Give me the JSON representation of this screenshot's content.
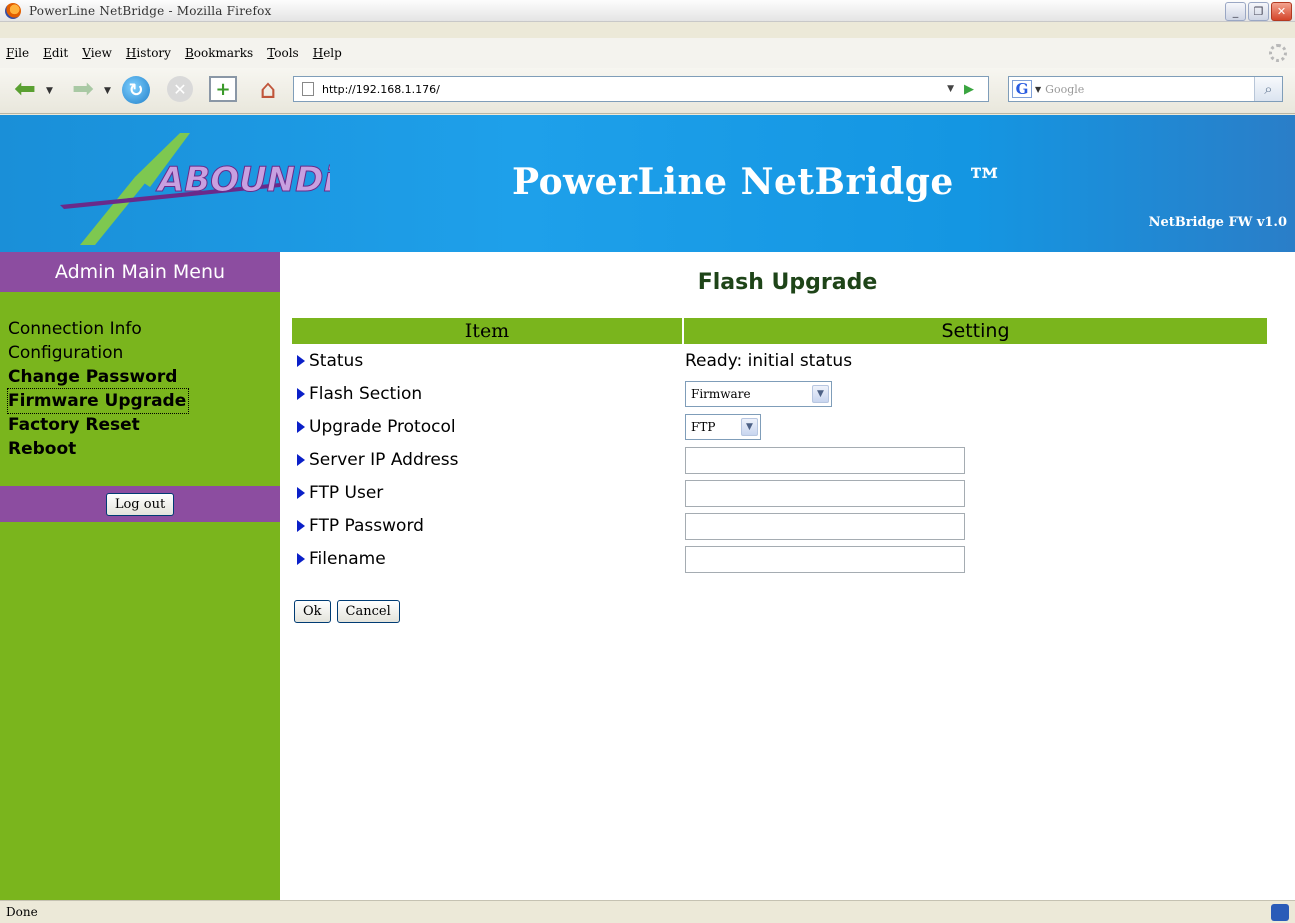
{
  "window": {
    "title": "PowerLine NetBridge - Mozilla Firefox",
    "controls": {
      "minimize": "_",
      "maximize": "❐",
      "close": "✕"
    }
  },
  "menubar": {
    "items": [
      "File",
      "Edit",
      "View",
      "History",
      "Bookmarks",
      "Tools",
      "Help"
    ]
  },
  "navbar": {
    "url": "http://192.168.1.176/",
    "search_placeholder": "Google",
    "google_glyph": "G"
  },
  "banner": {
    "logo_text": "ABOUNDi",
    "title": "PowerLine NetBridge ™",
    "fw_version": "NetBridge FW v1.0"
  },
  "sidebar": {
    "header": "Admin Main Menu",
    "items": [
      {
        "label": "Connection Info"
      },
      {
        "label": "Configuration"
      },
      {
        "label": "Change Password"
      },
      {
        "label": "Firmware Upgrade"
      },
      {
        "label": "Factory Reset"
      },
      {
        "label": "Reboot"
      }
    ],
    "logout_label": "Log out"
  },
  "main": {
    "title": "Flash Upgrade",
    "table": {
      "columns": [
        "Item",
        "Setting"
      ],
      "rows": [
        {
          "label": "Status",
          "value": "Ready: initial status"
        },
        {
          "label": "Flash Section",
          "value": "Firmware"
        },
        {
          "label": "Upgrade Protocol",
          "value": "FTP"
        },
        {
          "label": "Server IP Address",
          "value": ""
        },
        {
          "label": "FTP User",
          "value": ""
        },
        {
          "label": "FTP Password",
          "value": ""
        },
        {
          "label": "Filename",
          "value": ""
        }
      ]
    },
    "ok_label": "Ok",
    "cancel_label": "Cancel"
  },
  "statusbar": {
    "text": "Done"
  },
  "colors": {
    "sidebar_green": "#7ab51d",
    "sidebar_purple": "#8c4da0",
    "banner_blue": "#1ea0ea",
    "title_green": "#1e4418",
    "bullet_blue": "#0a1fc8"
  }
}
